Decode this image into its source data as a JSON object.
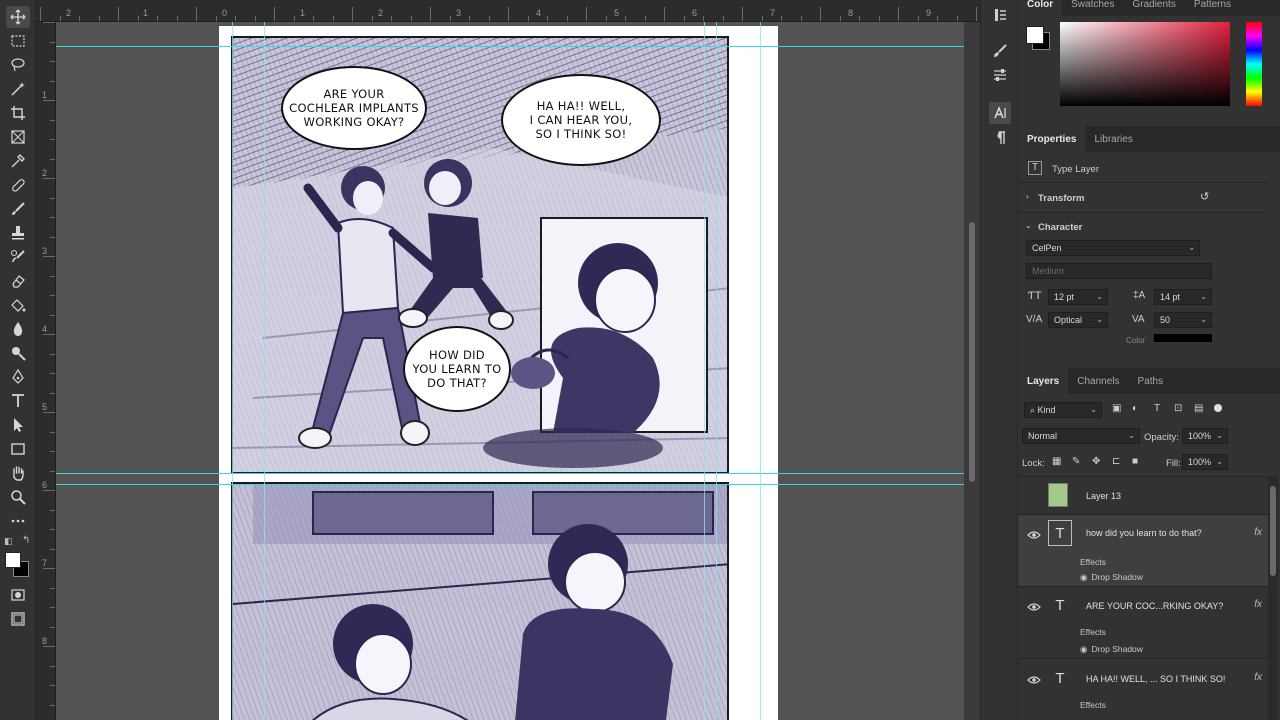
{
  "ruler_top": {
    "labels": [
      "2",
      "1",
      "0",
      "1",
      "2",
      "3",
      "4",
      "5",
      "6",
      "7",
      "8",
      "9"
    ]
  },
  "ruler_left": {
    "labels": [
      "1",
      "2",
      "3",
      "4",
      "5",
      "6",
      "7",
      "8"
    ]
  },
  "comic": {
    "bubbles": [
      "ARE YOUR\nCOCHLEAR IMPLANTS\nWORKING OKAY?",
      "HA HA!! WELL,\nI CAN HEAR YOU,\nSO I THINK SO!",
      "HOW DID\nYOU LEARN TO\nDO THAT?"
    ]
  },
  "color_panel": {
    "tabs": [
      "Color",
      "Swatches",
      "Gradients",
      "Patterns"
    ],
    "foreground": "#ffffff",
    "background": "#000000",
    "hue_color": "#e2203f"
  },
  "properties": {
    "tabs": [
      "Properties",
      "Libraries"
    ],
    "layer_kind": "Type Layer",
    "transform_label": "Transform",
    "character_label": "Character",
    "font_family": "CelPen",
    "font_style": "Medium",
    "font_size": "12 pt",
    "leading": "14 pt",
    "kerning": "Optical",
    "tracking": "50",
    "color_label": "Color"
  },
  "layers": {
    "tabs": [
      "Layers",
      "Channels",
      "Paths"
    ],
    "filter": "Kind",
    "blend_mode": "Normal",
    "opacity_label": "Opacity:",
    "opacity": "100%",
    "lock_label": "Lock:",
    "fill_label": "Fill:",
    "fill": "100%",
    "items": [
      {
        "name": "Layer 13",
        "type": "raster",
        "visible": false
      },
      {
        "name": "how did you learn to do that?",
        "type": "text",
        "visible": true,
        "effects": "Effects",
        "effect": "Drop Shadow"
      },
      {
        "name": "ARE YOUR COC...RKING OKAY?",
        "type": "text",
        "visible": true,
        "effects": "Effects",
        "effect": "Drop Shadow"
      },
      {
        "name": "HA HA!! WELL, ... SO I THINK SO!",
        "type": "text",
        "visible": true,
        "effects": "Effects"
      }
    ]
  }
}
